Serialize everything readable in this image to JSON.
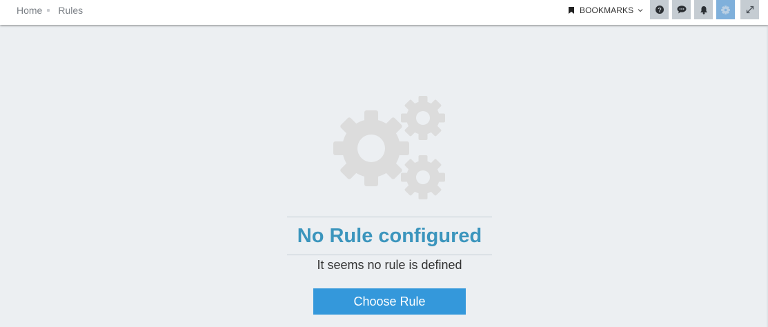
{
  "breadcrumb": {
    "items": [
      {
        "label": "Home"
      },
      {
        "label": "Rules"
      }
    ]
  },
  "toolbar": {
    "bookmarks_label": "BOOKMARKS",
    "buttons": [
      {
        "icon": "help-icon"
      },
      {
        "icon": "chat-icon"
      },
      {
        "icon": "bell-icon"
      },
      {
        "icon": "gear-icon",
        "active": true
      },
      {
        "icon": "expand-icon"
      }
    ]
  },
  "empty_state": {
    "icon": "gears-icon",
    "title": "No Rule configured",
    "subtitle": "It seems no rule is defined",
    "button_label": "Choose Rule"
  },
  "colors": {
    "background": "#eceff2",
    "title": "#3b95bd",
    "button": "#3498db",
    "toolbar_button": "#c5ccd2",
    "toolbar_button_active": "#7fb0db",
    "gears": "#dcdcdc"
  }
}
